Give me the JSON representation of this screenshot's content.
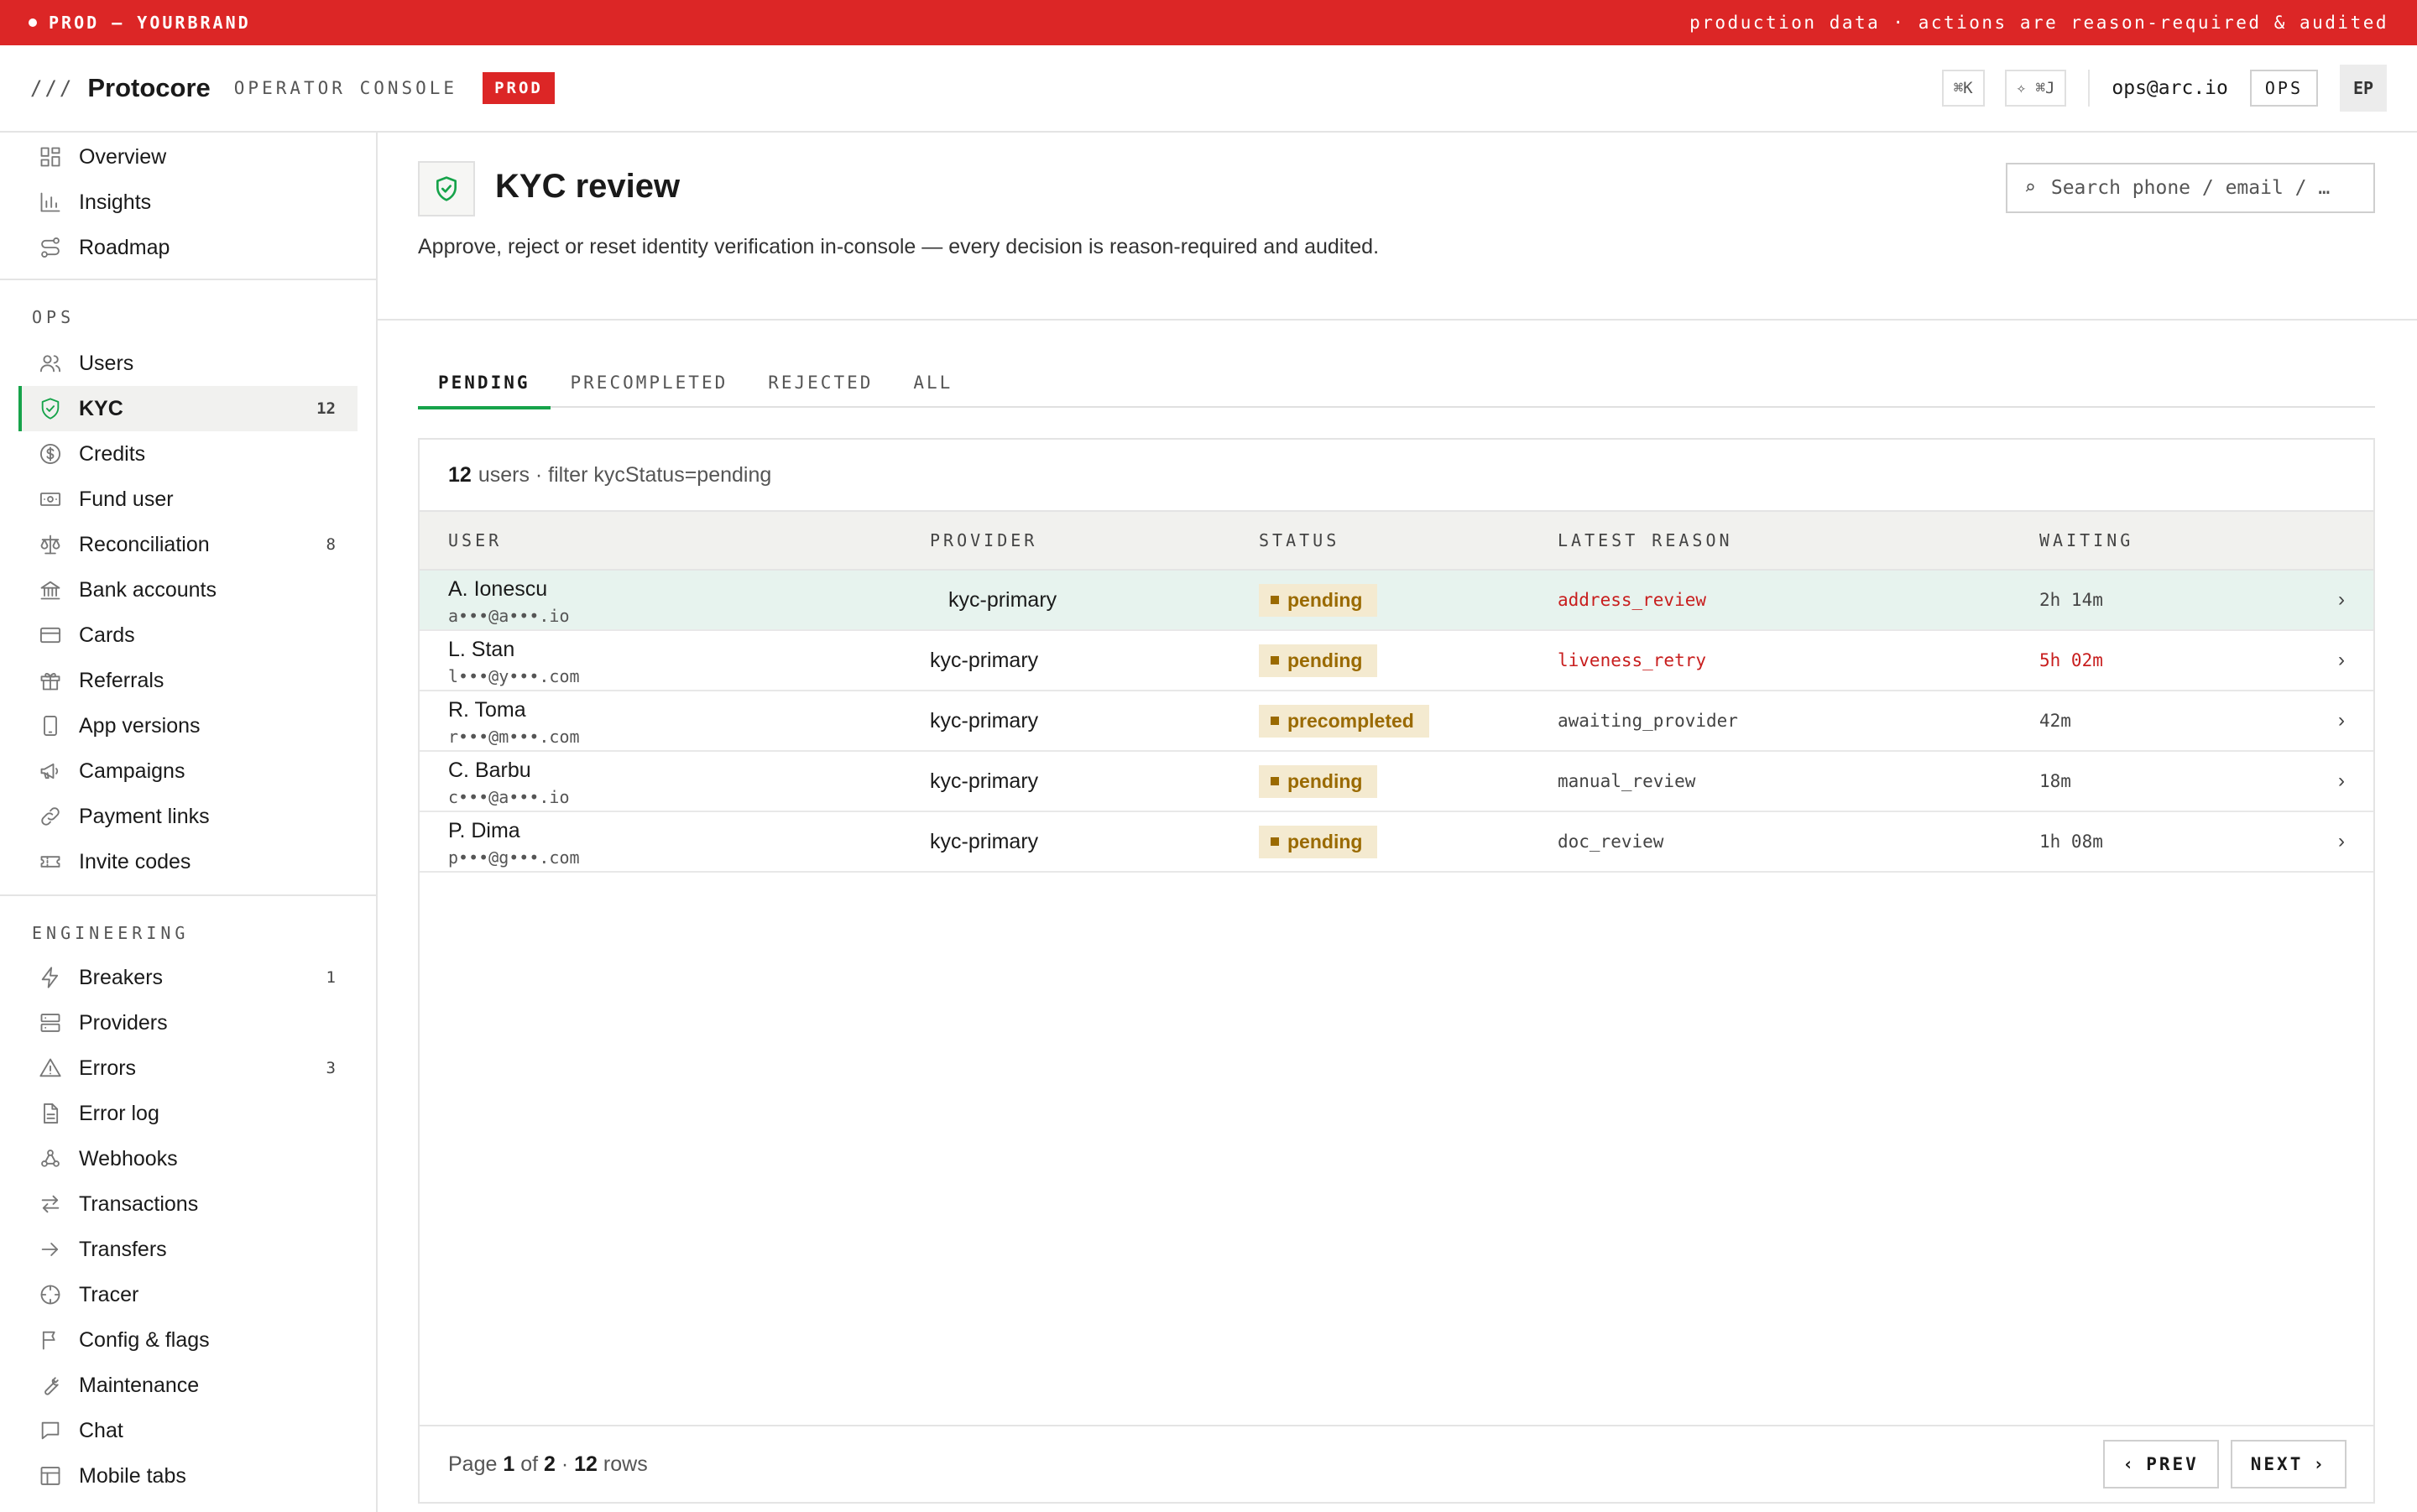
{
  "banner": {
    "env": "PROD — YOURBRAND",
    "notice": "production data · actions are reason-required & audited"
  },
  "topbar": {
    "slashes": "///",
    "brand": "Protocore",
    "subtitle": "OPERATOR CONSOLE",
    "env_pill": "PROD",
    "cmd_k": "⌘K",
    "cmd_j": "✧ ⌘J",
    "user_email": "ops@arc.io",
    "role": "OPS",
    "avatar": "EP"
  },
  "sidebar": {
    "top": [
      {
        "label": "Overview",
        "icon": "grid-icon"
      },
      {
        "label": "Insights",
        "icon": "bar-chart-icon"
      },
      {
        "label": "Roadmap",
        "icon": "route-icon"
      }
    ],
    "ops_title": "OPS",
    "ops": [
      {
        "label": "Users",
        "icon": "users-icon",
        "count": ""
      },
      {
        "label": "KYC",
        "icon": "shield-check-icon",
        "count": "12"
      },
      {
        "label": "Credits",
        "icon": "dollar-circle-icon",
        "count": ""
      },
      {
        "label": "Fund user",
        "icon": "banknote-icon",
        "count": ""
      },
      {
        "label": "Reconciliation",
        "icon": "scale-icon",
        "count": "8"
      },
      {
        "label": "Bank accounts",
        "icon": "bank-icon",
        "count": ""
      },
      {
        "label": "Cards",
        "icon": "card-icon",
        "count": ""
      },
      {
        "label": "Referrals",
        "icon": "gift-icon",
        "count": ""
      },
      {
        "label": "App versions",
        "icon": "phone-icon",
        "count": ""
      },
      {
        "label": "Campaigns",
        "icon": "megaphone-icon",
        "count": ""
      },
      {
        "label": "Payment links",
        "icon": "link-icon",
        "count": ""
      },
      {
        "label": "Invite codes",
        "icon": "ticket-icon",
        "count": ""
      }
    ],
    "eng_title": "ENGINEERING",
    "eng": [
      {
        "label": "Breakers",
        "icon": "bolt-icon",
        "count": "1"
      },
      {
        "label": "Providers",
        "icon": "server-icon",
        "count": ""
      },
      {
        "label": "Errors",
        "icon": "warning-icon",
        "count": "3"
      },
      {
        "label": "Error log",
        "icon": "file-icon",
        "count": ""
      },
      {
        "label": "Webhooks",
        "icon": "webhook-icon",
        "count": ""
      },
      {
        "label": "Transactions",
        "icon": "swap-icon",
        "count": ""
      },
      {
        "label": "Transfers",
        "icon": "arrow-right-icon",
        "count": ""
      },
      {
        "label": "Tracer",
        "icon": "crosshair-icon",
        "count": ""
      },
      {
        "label": "Config & flags",
        "icon": "flag-icon",
        "count": ""
      },
      {
        "label": "Maintenance",
        "icon": "wrench-icon",
        "count": ""
      },
      {
        "label": "Chat",
        "icon": "chat-icon",
        "count": ""
      },
      {
        "label": "Mobile tabs",
        "icon": "layout-icon",
        "count": ""
      }
    ]
  },
  "page": {
    "title": "KYC review",
    "description": "Approve, reject or reset identity verification in-console — every decision is reason-required and audited.",
    "search_placeholder": "Search phone / email / …",
    "search_glyph": "⌕"
  },
  "tabs": [
    "PENDING",
    "PRECOMPLETED",
    "REJECTED",
    "ALL"
  ],
  "summary": {
    "count": "12",
    "text": "users · filter kycStatus=pending"
  },
  "table": {
    "headers": [
      "USER",
      "PROVIDER",
      "STATUS",
      "LATEST REASON",
      "WAITING"
    ],
    "rows": [
      {
        "name": "A. Ionescu",
        "email": "a•••@a•••.io",
        "provider": "kyc-primary",
        "status": "pending",
        "reason": "address_review",
        "waiting": "2h 14m"
      },
      {
        "name": "L. Stan",
        "email": "l•••@y•••.com",
        "provider": "kyc-primary",
        "status": "pending",
        "reason": "liveness_retry",
        "waiting": "5h 02m"
      },
      {
        "name": "R. Toma",
        "email": "r•••@m•••.com",
        "provider": "kyc-primary",
        "status": "precompleted",
        "reason": "awaiting_provider",
        "waiting": "42m"
      },
      {
        "name": "C. Barbu",
        "email": "c•••@a•••.io",
        "provider": "kyc-primary",
        "status": "pending",
        "reason": "manual_review",
        "waiting": "18m"
      },
      {
        "name": "P. Dima",
        "email": "p•••@g•••.com",
        "provider": "kyc-primary",
        "status": "pending",
        "reason": "doc_review",
        "waiting": "1h 08m"
      }
    ],
    "chevron": "›"
  },
  "footer": {
    "page_label": "Page",
    "page": "1",
    "of_label": "of",
    "pages": "2",
    "sep": "·",
    "rows": "12",
    "rows_label": "rows",
    "prev": "PREV",
    "next": "NEXT",
    "prev_glyph": "‹",
    "next_glyph": "›"
  },
  "colors": {
    "brand_red": "#dc2626",
    "accent_green": "#16a34a",
    "pending_bg": "#f4ead0",
    "pending_fg": "#9a6a00",
    "alert_red": "#c81e1e"
  }
}
